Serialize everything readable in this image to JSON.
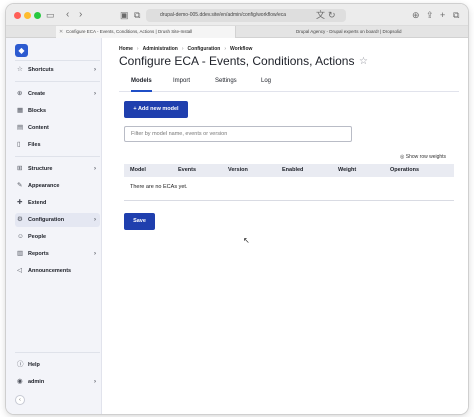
{
  "browser": {
    "url": "drupal-demo-005.ddev.site/en/admin/config/workflow/eca",
    "tabs": [
      {
        "label": "Configure ECA - Events, Conditions, Actions | Drush Site-Install"
      },
      {
        "label": "Drupal Agency - Drupal experts on board! | Dropsolid"
      }
    ]
  },
  "sidebar": {
    "items": [
      {
        "label": "Shortcuts",
        "icon": "star-icon"
      },
      {
        "label": "Create",
        "icon": "plus-icon"
      },
      {
        "label": "Blocks",
        "icon": "blocks-icon"
      },
      {
        "label": "Content",
        "icon": "document-icon"
      },
      {
        "label": "Files",
        "icon": "file-icon"
      },
      {
        "label": "Structure",
        "icon": "structure-icon"
      },
      {
        "label": "Appearance",
        "icon": "brush-icon"
      },
      {
        "label": "Extend",
        "icon": "puzzle-icon"
      },
      {
        "label": "Configuration",
        "icon": "wrench-icon"
      },
      {
        "label": "People",
        "icon": "people-icon"
      },
      {
        "label": "Reports",
        "icon": "chart-icon"
      },
      {
        "label": "Announcements",
        "icon": "megaphone-icon"
      },
      {
        "label": "Help",
        "icon": "help-icon"
      },
      {
        "label": "admin",
        "icon": "user-icon"
      }
    ]
  },
  "breadcrumb": [
    "Home",
    "Administration",
    "Configuration",
    "Workflow"
  ],
  "page": {
    "title": "Configure ECA - Events, Conditions, Actions",
    "tabs": [
      "Models",
      "Import",
      "Settings",
      "Log"
    ],
    "add_button": "+ Add new model",
    "filter_placeholder": "Filter by model name, events or version",
    "show_weights": "Show row weights",
    "table_headers": [
      "Model",
      "Events",
      "Version",
      "Enabled",
      "Weight",
      "Operations"
    ],
    "empty_text": "There are no ECAs yet.",
    "save_button": "Save"
  },
  "colors": {
    "accent": "#1f3fae",
    "brand": "#2d5bd0"
  }
}
